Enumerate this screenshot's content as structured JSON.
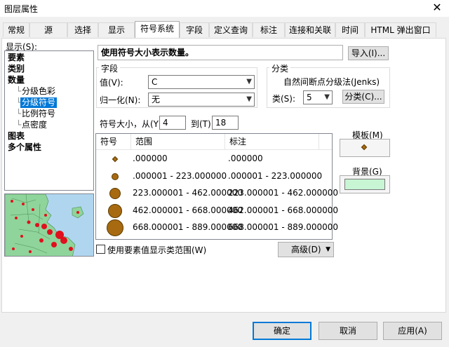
{
  "window": {
    "title": "图层属性",
    "close_glyph": "✕"
  },
  "tabs": [
    "常规",
    "源",
    "选择",
    "显示",
    "符号系统",
    "字段",
    "定义查询",
    "标注",
    "连接和关联",
    "时间",
    "HTML 弹出窗口"
  ],
  "active_tab": "符号系统",
  "show": {
    "label": "显示(S):",
    "tree": {
      "features": "要素",
      "categories": "类别",
      "quantities": "数量",
      "graduated_colors": "分级色彩",
      "graduated_symbols": "分级符号",
      "proportional_symbols": "比例符号",
      "dot_density": "点密度",
      "charts": "图表",
      "multiple_attributes": "多个属性"
    }
  },
  "description": "使用符号大小表示数量。",
  "import_button": "导入(I)...",
  "fields": {
    "group_title": "字段",
    "value_label": "值(V):",
    "value": "C",
    "normalize_label": "归一化(N):",
    "normalize": "无"
  },
  "classification": {
    "group_title": "分类",
    "method": "自然间断点分级法(Jenks)",
    "classes_label": "类(S):",
    "classes": "5",
    "classify_button": "分类(C)..."
  },
  "size": {
    "from_label": "符号大小，从(Y)",
    "from": "4",
    "to_label": "到(T):",
    "to": "18"
  },
  "table": {
    "headers": [
      "符号",
      "范围",
      "标注"
    ],
    "rows": [
      {
        "range": ".000000",
        "label": ".000000",
        "size_level": 1
      },
      {
        "range": ".000001 - 223.000000",
        "label": ".000001 - 223.000000",
        "size_level": 2
      },
      {
        "range": "223.000001 - 462.000000",
        "label": "223.000001 - 462.000000",
        "size_level": 3
      },
      {
        "range": "462.000001 - 668.000000",
        "label": "462.000001 - 668.000000",
        "size_level": 4
      },
      {
        "range": "668.000001 - 889.000000",
        "label": "668.000001 - 889.000000",
        "size_level": 5
      }
    ]
  },
  "template": {
    "label": "模板(M)"
  },
  "background": {
    "label": "背景(G)",
    "color": "#c8f5d4"
  },
  "symbol_color": "#a86a10",
  "use_feature_values": "使用要素值显示类范围(W)",
  "advanced_button": "高级(D)",
  "buttons": {
    "ok": "确定",
    "cancel": "取消",
    "apply": "应用(A)"
  }
}
